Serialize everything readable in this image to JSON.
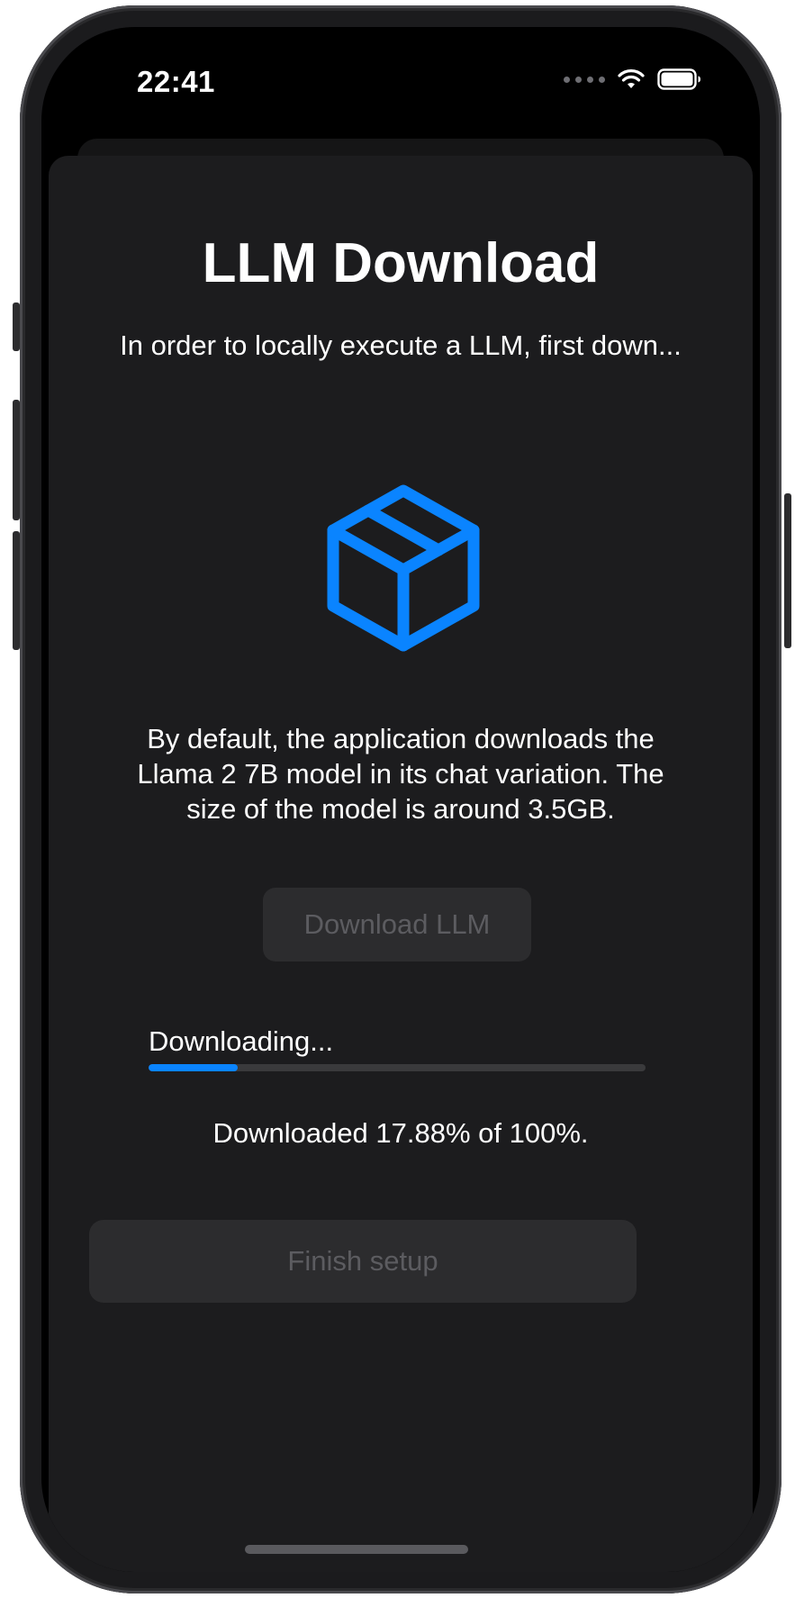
{
  "status_bar": {
    "time": "22:41",
    "icons": [
      "cellular-dots-icon",
      "wifi-icon",
      "battery-icon"
    ]
  },
  "sheet": {
    "title": "LLM Download",
    "subtitle": "In order to locally execute a LLM, first down...",
    "icon": "shippingbox-icon",
    "description": "By default, the application downloads the Llama 2 7B model in its chat variation. The size of the model is around 3.5GB.",
    "download_button_label": "Download LLM",
    "download_button_enabled": false,
    "progress_label": "Downloading...",
    "progress_fraction": 0.1788,
    "downloaded_text": "Downloaded 17.88% of 100%.",
    "finish_button_label": "Finish setup",
    "finish_button_enabled": false
  },
  "colors": {
    "accent": "#0a84ff",
    "background": "#000000",
    "sheet_background": "#1c1c1e",
    "disabled_button_bg": "#2c2c2e",
    "disabled_button_text": "#5c5c60",
    "text": "#ffffff"
  }
}
